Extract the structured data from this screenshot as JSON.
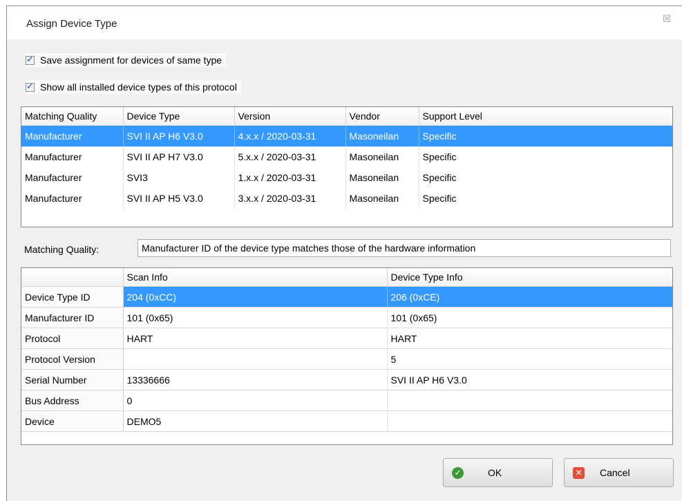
{
  "dialog": {
    "title": "Assign Device Type",
    "close_glyph": "☒"
  },
  "options": {
    "save_assignment": {
      "label": "Save assignment for devices of same type",
      "checked": true
    },
    "show_all": {
      "label": "Show all installed device types of this protocol",
      "checked": true
    }
  },
  "device_table": {
    "columns": [
      "Matching Quality",
      "Device Type",
      "Version",
      "Vendor",
      "Support Level"
    ],
    "rows": [
      [
        "Manufacturer",
        "SVI II AP H6 V3.0",
        "4.x.x / 2020-03-31",
        "Masoneilan",
        "Specific"
      ],
      [
        "Manufacturer",
        "SVI II AP H7 V3.0",
        "5.x.x / 2020-03-31",
        "Masoneilan",
        "Specific"
      ],
      [
        "Manufacturer",
        "SVI3",
        "1.x.x / 2020-03-31",
        "Masoneilan",
        "Specific"
      ],
      [
        "Manufacturer",
        "SVI II AP H5 V3.0",
        "3.x.x / 2020-03-31",
        "Masoneilan",
        "Specific"
      ]
    ],
    "selected_row": 0
  },
  "matching_quality": {
    "label": "Matching Quality:",
    "value": "Manufacturer ID of the device type matches those of the hardware information"
  },
  "info_table": {
    "columns": [
      "",
      "Scan Info",
      "Device Type Info"
    ],
    "rows": [
      [
        "Device Type ID",
        "204 (0xCC)",
        "206 (0xCE)"
      ],
      [
        "Manufacturer ID",
        "101 (0x65)",
        "101 (0x65)"
      ],
      [
        "Protocol",
        "HART",
        "HART"
      ],
      [
        "Protocol Version",
        "",
        "5"
      ],
      [
        "Serial Number",
        "13336666",
        "SVI II AP H6 V3.0"
      ],
      [
        "Bus Address",
        "0",
        ""
      ],
      [
        "Device",
        "DEMO5",
        ""
      ]
    ],
    "selected_row": 0
  },
  "buttons": {
    "ok": {
      "label": "OK",
      "icon": "check-circle-icon"
    },
    "cancel": {
      "label": "Cancel",
      "icon": "cancel-x-icon"
    }
  },
  "colors": {
    "selection": "#3399ff",
    "ok_icon": "#3c9a34",
    "cancel_icon": "#e04f3c"
  }
}
